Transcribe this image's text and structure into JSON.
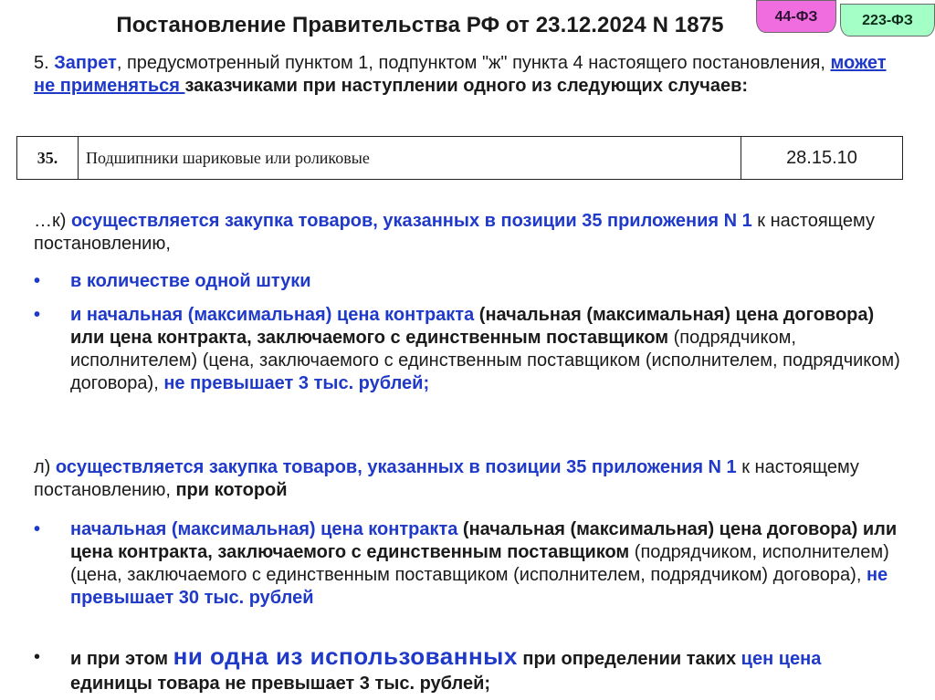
{
  "header": {
    "title": "Постановление Правительства РФ от 23.12.2024 N 1875",
    "tag44": "44-ФЗ",
    "tag223": "223-ФЗ"
  },
  "intro": {
    "num": "5. ",
    "zapret": "Запрет",
    "t1": ", предусмотренный пунктом 1, подпунктом \"ж\" пункта 4 настоящего постановления, ",
    "link": "может не применяться ",
    "t2": "заказчиками при наступлении одного из следующих случаев:"
  },
  "table": {
    "num": "35.",
    "name": "Подшипники шариковые или роликовые",
    "code": "28.15.10"
  },
  "k": {
    "lead": "…к) ",
    "blue": "осуществляется закупка товаров, указанных в позиции 35 приложения N 1",
    "rest": " к настоящему постановлению,",
    "bullet1": "в количестве одной штуки",
    "b2_blue": "и начальная (максимальная) цена контракта",
    "b2_bold": " (начальная (максимальная) цена договора) или цена контракта, заключаемого с единственным поставщиком",
    "b2_plain": " (подрядчиком, исполнителем) (цена, заключаемого с единственным поставщиком (исполнителем, подрядчиком) договора), ",
    "b2_end": "не превышает 3 тыс. рублей;"
  },
  "l": {
    "lead": "л) ",
    "blue": "осуществляется закупка товаров, указанных в позиции 35 приложения N 1",
    "rest": " к настоящему постановлению, ",
    "rest_bold": "при которой",
    "b1_blue": "начальная (максимальная) цена контракта",
    "b1_bold": " (начальная (максимальная) цена договора) или цена контракта, заключаемого с единственным поставщиком",
    "b1_plain": " (подрядчиком, исполнителем) (цена, заключаемого с единственным поставщиком (исполнителем, подрядчиком) договора), ",
    "b1_end": "не превышает 30 тыс. рублей",
    "b2_bold1": "и при этом ",
    "b2_big": "ни одна из использованных",
    "b2_bold2": " при определении таких ",
    "b2_blue": "цен цена",
    "b2_bold3": " единицы товара не превышает 3 тыс. рублей;"
  },
  "bullet_char": "•"
}
